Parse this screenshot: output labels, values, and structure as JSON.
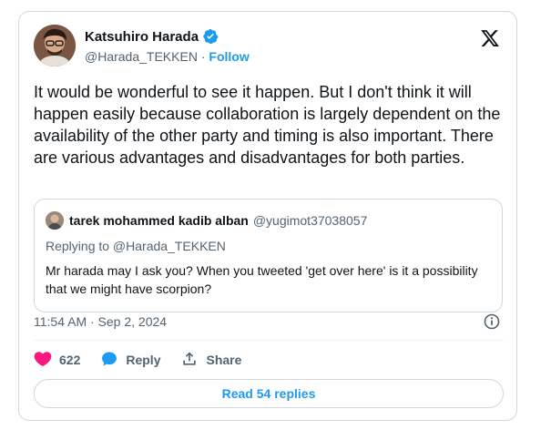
{
  "author": {
    "name": "Katsuhiro Harada",
    "handle": "@Harada_TEKKEN",
    "separator": "·",
    "follow_label": "Follow"
  },
  "tweet": {
    "text": "It would be wonderful to see it happen. But I don't think it will happen easily because collaboration is largely dependent on the availability of the other party and timing is also important. There are various advantages and disadvantages for both parties."
  },
  "quoted": {
    "name": "tarek mohammed kadib alban",
    "handle": "@yugimot37038057",
    "replying_to": "Replying to @Harada_TEKKEN",
    "text": "Mr harada may I ask you? When you tweeted 'get over here' is it a possibility that we might have scorpion?"
  },
  "timestamp": "11:54 AM · Sep 2, 2024",
  "actions": {
    "like_count": "622",
    "reply_label": "Reply",
    "share_label": "Share"
  },
  "read_replies_label": "Read 54 replies",
  "colors": {
    "accent": "#1d9bf0",
    "like": "#f91880",
    "text": "#0f1419",
    "muted": "#536471",
    "border": "#cfd9de"
  },
  "icons": [
    "x-logo-icon",
    "verified-badge-icon",
    "info-icon",
    "heart-icon",
    "reply-bubble-icon",
    "share-icon"
  ]
}
